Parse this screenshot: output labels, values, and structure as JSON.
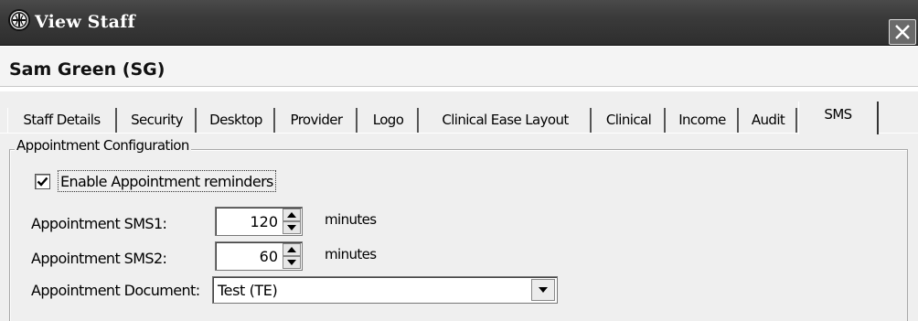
{
  "window": {
    "title": "View Staff",
    "icon": "app-globe-icon",
    "close_icon": "close-icon"
  },
  "header": {
    "staff_name": "Sam Green (SG)"
  },
  "tabs": [
    {
      "label": "Staff Details",
      "active": false
    },
    {
      "label": "Security",
      "active": false
    },
    {
      "label": "Desktop",
      "active": false
    },
    {
      "label": "Provider",
      "active": false
    },
    {
      "label": "Logo",
      "active": false
    },
    {
      "label": "Clinical Ease Layout",
      "active": false
    },
    {
      "label": "Clinical",
      "active": false
    },
    {
      "label": "Income",
      "active": false
    },
    {
      "label": "Audit",
      "active": false
    },
    {
      "label": "SMS",
      "active": true
    }
  ],
  "appointment_config": {
    "group_title": "Appointment Configuration",
    "enable_reminders": {
      "label": "Enable Appointment reminders",
      "checked": true
    },
    "sms1": {
      "label": "Appointment SMS1:",
      "value": "120",
      "unit": "minutes"
    },
    "sms2": {
      "label": "Appointment SMS2:",
      "value": "60",
      "unit": "minutes"
    },
    "document": {
      "label": "Appointment Document:",
      "value": "Test (TE)"
    }
  }
}
